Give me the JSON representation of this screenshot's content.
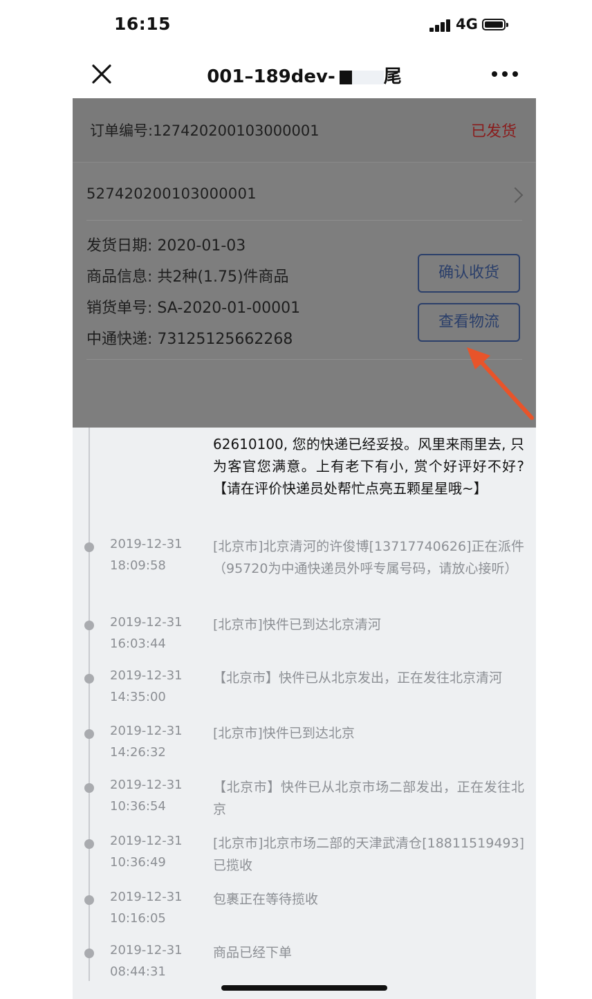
{
  "status_bar": {
    "time": "16:15",
    "network": "4G"
  },
  "nav": {
    "title": "001–189dev-",
    "title_suffix": "尾"
  },
  "order": {
    "number_label": "订单编号:127420200103000001",
    "status": "已发货",
    "status_color": "#8a1c1c",
    "sub_order": "527420200103000001",
    "ship_date": "发货日期: 2020-01-03",
    "goods_info": "商品信息: 共2种(1.75)件商品",
    "sales_no": "销货单号: SA-2020-01-00001",
    "express": "中通快递: 73125125662268",
    "confirm_button": "确认收货",
    "logistics_button": "查看物流"
  },
  "timeline": {
    "top_description": "62610100, 您的快递已经妥投。风里来雨里去, 只为客官您满意。上有老下有小, 赏个好评好不好? 【请在评价快递员处帮忙点亮五颗星星哦~】",
    "events": [
      {
        "date": "2019-12-31",
        "time": "18:09:58",
        "desc": "[北京市]北京清河的许俊博[13717740626]正在派件（95720为中通快递员外呼专属号码，请放心接听）"
      },
      {
        "date": "2019-12-31",
        "time": "16:03:44",
        "desc": "[北京市]快件已到达北京清河"
      },
      {
        "date": "2019-12-31",
        "time": "14:35:00",
        "desc": "【北京市】快件已从北京发出，正在发往北京清河"
      },
      {
        "date": "2019-12-31",
        "time": "14:26:32",
        "desc": "[北京市]快件已到达北京"
      },
      {
        "date": "2019-12-31",
        "time": "10:36:54",
        "desc": "【北京市】快件已从北京市场二部发出，正在发往北京"
      },
      {
        "date": "2019-12-31",
        "time": "10:36:49",
        "desc": "[北京市]北京市场二部的天津武清仓[18811519493]已揽收"
      },
      {
        "date": "2019-12-31",
        "time": "10:16:05",
        "desc": "包裹正在等待揽收"
      },
      {
        "date": "2019-12-31",
        "time": "08:44:31",
        "desc": "商品已经下单"
      }
    ]
  },
  "colors": {
    "accent_button": "#2b3f6a",
    "arrow": "#e8542a"
  }
}
